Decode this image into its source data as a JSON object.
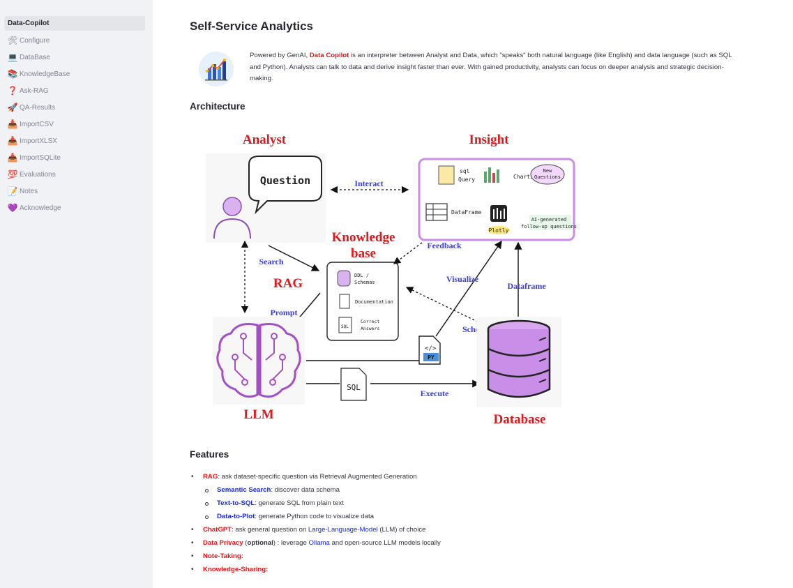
{
  "sidebar": {
    "items": [
      {
        "icon": "",
        "icon_name": "none",
        "label": "Data-Copilot",
        "active": true
      },
      {
        "icon": "🛠",
        "icon_name": "hammer-wrench-icon",
        "label": "Configure"
      },
      {
        "icon": "💻",
        "icon_name": "laptop-icon",
        "label": "DataBase"
      },
      {
        "icon": "📚",
        "icon_name": "books-icon",
        "label": "KnowledgeBase"
      },
      {
        "icon": "❓",
        "icon_name": "question-icon",
        "label": "Ask-RAG"
      },
      {
        "icon": "🚀",
        "icon_name": "rocket-icon",
        "label": "QA-Results"
      },
      {
        "icon": "📥",
        "icon_name": "inbox-tray-icon",
        "label": "ImportCSV"
      },
      {
        "icon": "📥",
        "icon_name": "inbox-tray-icon",
        "label": "ImportXLSX"
      },
      {
        "icon": "📥",
        "icon_name": "inbox-tray-icon",
        "label": "ImportSQLite"
      },
      {
        "icon": "💯",
        "icon_name": "hundred-points-icon",
        "label": "Evaluations"
      },
      {
        "icon": "📝",
        "icon_name": "memo-icon",
        "label": "Notes"
      },
      {
        "icon": "💜",
        "icon_name": "purple-heart-icon",
        "label": "Acknowledge"
      }
    ]
  },
  "main": {
    "title": "Self-Service Analytics",
    "intro": {
      "before": "Powered by GenAI, ",
      "highlight": "Data Copilot",
      "after": " is an interpreter between Analyst and Data, which \"speaks\" both natural language (like English) and data language (such as SQL and Python). Analysts can talk to data and derive insight faster than ever. With gained productivity, analysts can focus on deeper analysis and strategic decision-making."
    },
    "architecture_heading": "Architecture",
    "features_heading": "Features"
  },
  "diagram": {
    "analyst": "Analyst",
    "insight": "Insight",
    "knowledge_line1": "Knowledge",
    "knowledge_line2": "base",
    "rag": "RAG",
    "llm": "LLM",
    "database": "Database",
    "question_bubble": "Question",
    "interact": "Interact",
    "feedback": "Feedback",
    "search": "Search",
    "prompt": "Prompt",
    "visualize": "Visualize",
    "dataframe_arrow": "Dataframe",
    "schema": "Schema",
    "execute": "Execute",
    "kb_items": [
      "DDL /",
      "Schemas",
      "Documentation",
      "Correct",
      "Answers"
    ],
    "insight_items": [
      "sql",
      "Query",
      "Charts",
      "New",
      "Questions",
      "DataFrame",
      "Plotly",
      "AI-generated",
      "follow-up questions"
    ],
    "sql_doc": "SQL",
    "py_doc": "PY",
    "colors": {
      "red": "#e0171b",
      "blue": "#3b3bd9",
      "purple": "#c98ee8"
    }
  },
  "features": {
    "rag": {
      "name": "RAG",
      "text": ": ask dataset-specific question via Retrieval Augmented Generation"
    },
    "semantic": {
      "name": "Semantic Search",
      "text": ": discover data schema"
    },
    "text2sql": {
      "name": "Text-to-SQL",
      "text": ": generate SQL from plain text"
    },
    "data2plot": {
      "name": "Data-to-Plot",
      "text": ": generate Python code to visualize data"
    },
    "chatgpt": {
      "name": "ChatGPT",
      "text_a": ": ask general question on ",
      "link": "Large-Language-Model",
      "text_b": " (LLM) of choice"
    },
    "privacy": {
      "name": "Data Privacy",
      "paren_open": " (",
      "optional": "optional",
      "paren_close": ") : leverage ",
      "link": "Ollama",
      "text": " and open-source LLM models locally"
    },
    "notetaking": {
      "name": "Note-Taking",
      "colon": ":"
    },
    "knowledge": {
      "name": "Knowledge-Sharing",
      "colon": ":"
    }
  }
}
